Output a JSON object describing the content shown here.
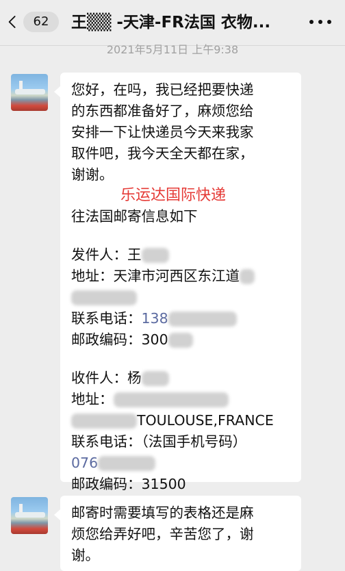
{
  "header": {
    "unread_count": "62",
    "title": "王▒▒ -天津-FR法国 衣物..."
  },
  "timestamp": "2021年5月11日 上午9:38",
  "messages": [
    {
      "intro_lines": [
        "您好，在吗，我已经把要快递",
        "的东西都准备好了，麻烦您给",
        "安排一下让快递员今天来我家",
        "取件吧，我今天全天都在家，",
        "谢谢。"
      ],
      "stamp_text": "乐运达国际快递",
      "heading": "往法国邮寄信息如下",
      "sender": {
        "name_label": "发件人：",
        "name_value": "王",
        "address_label": "地址：",
        "address_value": "天津市河西区东江道",
        "phone_label": "联系电话：",
        "phone_value": "138",
        "zip_label": "邮政编码：",
        "zip_value": "300"
      },
      "recipient": {
        "name_label": "收件人：",
        "name_value": "杨",
        "address_label": "地址：",
        "address_line2": "TOULOUSE,FRANCE",
        "phone_label": "联系电话：",
        "phone_note": "（法国手机号码）",
        "phone_value": "076",
        "zip_label": "邮政编码：",
        "zip_value": "31500"
      }
    },
    {
      "lines": [
        "邮寄时需要填写的表格还是麻",
        "烦您给弄好吧，辛苦您了，谢",
        "谢。"
      ]
    }
  ]
}
